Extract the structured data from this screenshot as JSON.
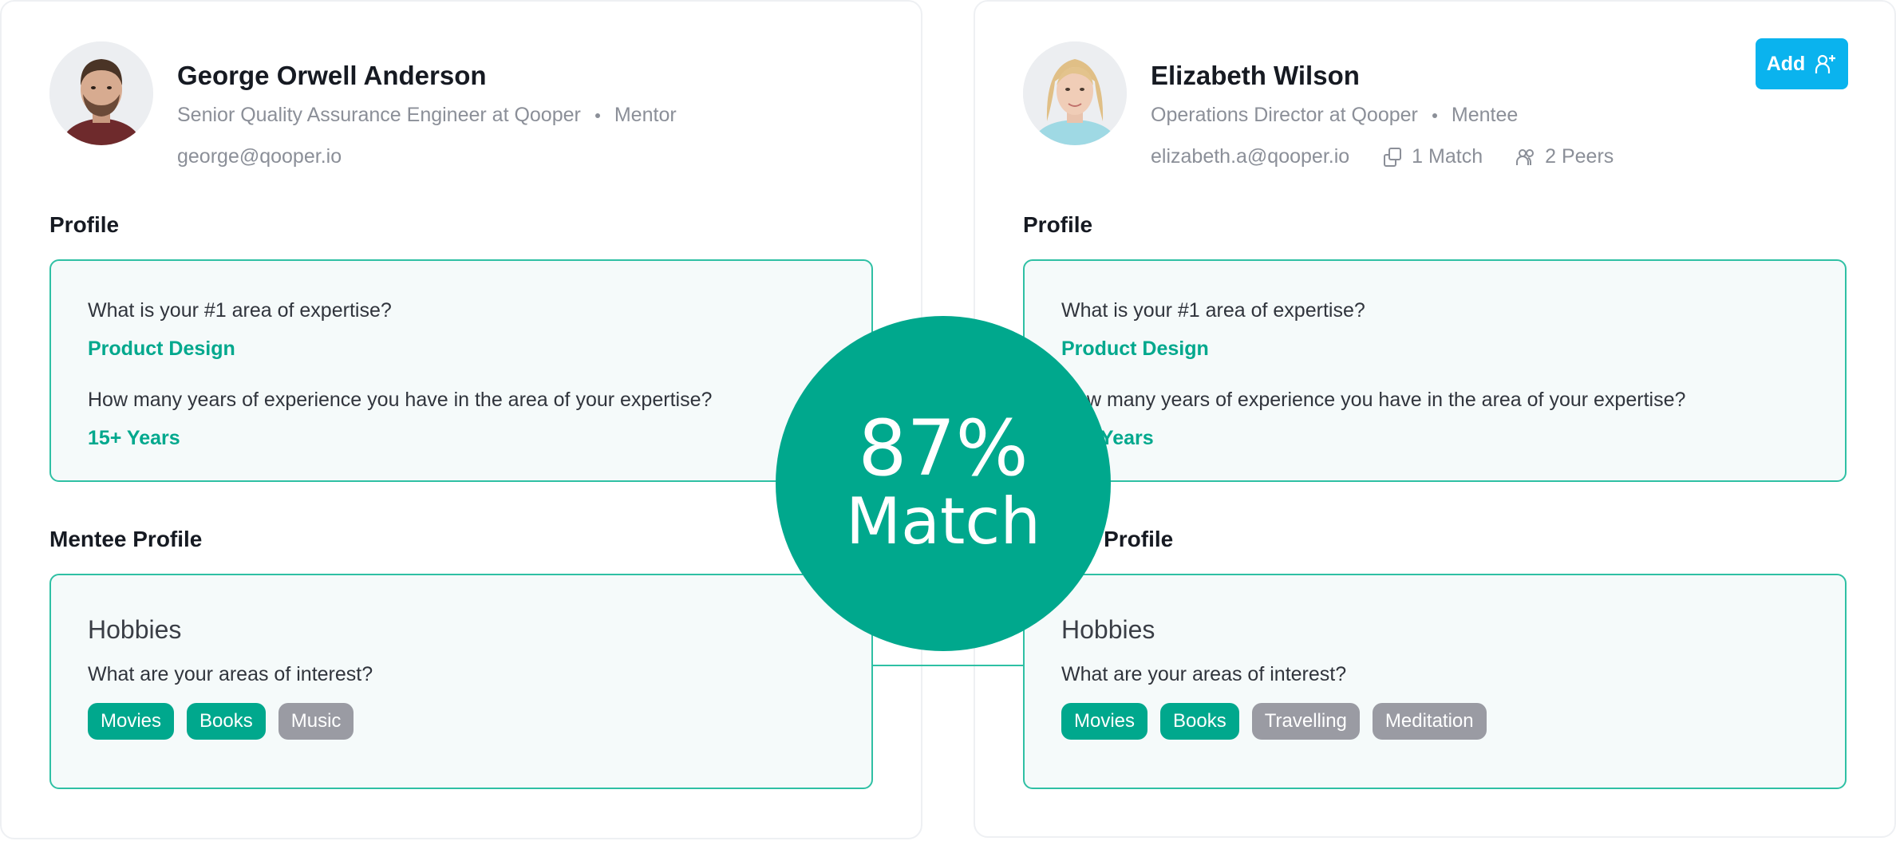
{
  "left": {
    "name": "George Orwell Anderson",
    "title": "Senior Quality Assurance Engineer at Qooper",
    "role": "Mentor",
    "email": "george@qooper.io",
    "profile_heading": "Profile",
    "profile": {
      "q1": "What is your #1 area of expertise?",
      "a1": "Product Design",
      "q2": "How many years of experience you have in the area of your expertise?",
      "a2": "15+ Years"
    },
    "section2_heading": "Mentee Profile",
    "hobbies": {
      "title": "Hobbies",
      "question": "What are your areas of interest?",
      "chips": [
        "Movies",
        "Books",
        "Music"
      ]
    }
  },
  "right": {
    "name": "Elizabeth Wilson",
    "title": "Operations Director at Qooper",
    "role": "Mentee",
    "email": "elizabeth.a@qooper.io",
    "matches": "1 Match",
    "peers": "2 Peers",
    "add_label": "Add",
    "profile_heading": "Profile",
    "profile": {
      "q1": "What is your #1 area of expertise?",
      "a1": "Product Design",
      "q2": "How many years of experience you have in the area of your expertise?",
      "a2": "15+ Years"
    },
    "section2_heading": "Mentor Profile",
    "hobbies": {
      "title": "Hobbies",
      "question": "What are your areas of interest?",
      "chips": [
        "Movies",
        "Books",
        "Travelling",
        "Meditation"
      ]
    }
  },
  "match": {
    "percent": "87%",
    "label": "Match"
  },
  "colors": {
    "accent_green": "#00a88d",
    "panel_border": "#2fc0a4",
    "panel_bg": "#f5fafa",
    "add_button": "#0ab3ee",
    "chip_gray": "#9a9ba3",
    "muted_text": "#8b8f98"
  },
  "icons": {
    "matches": "copy-squares-icon",
    "peers": "people-icon",
    "add": "add-user-icon"
  }
}
